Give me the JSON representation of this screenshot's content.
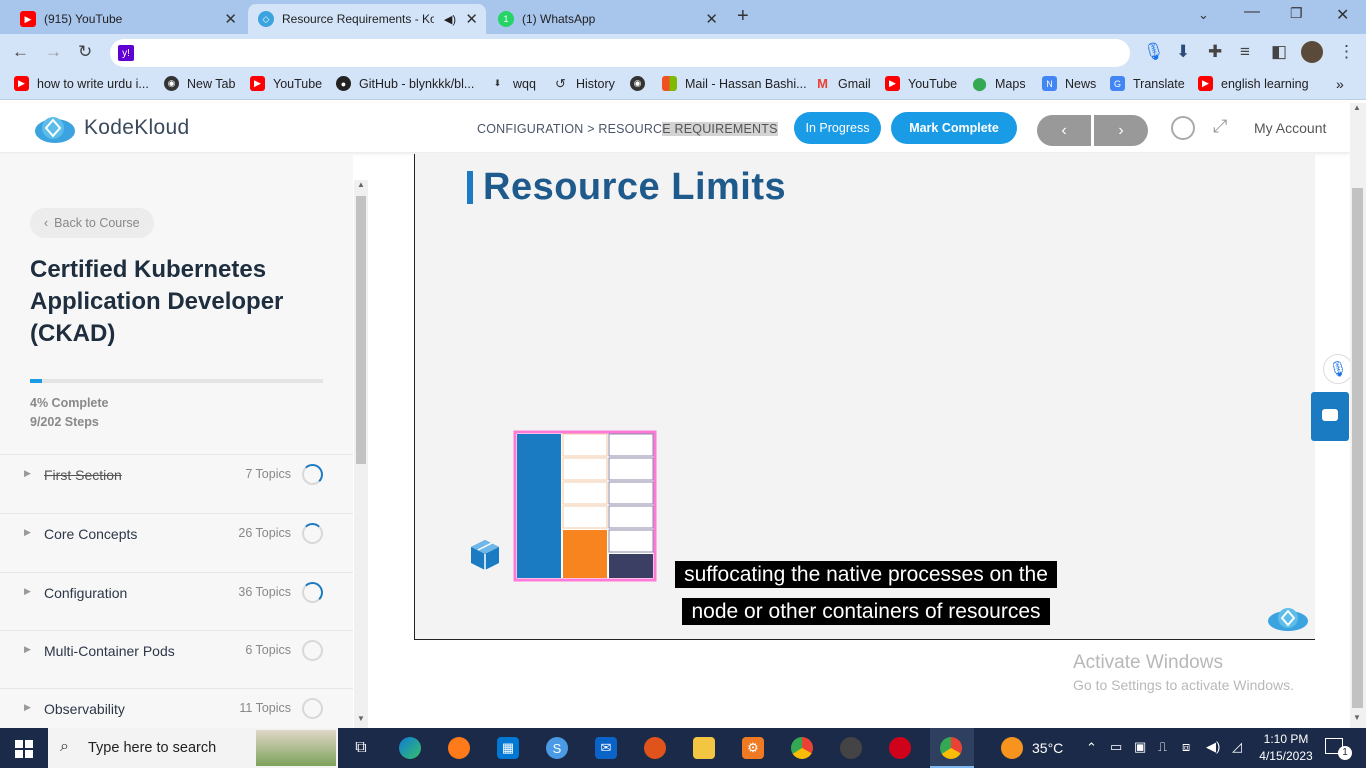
{
  "browser": {
    "tabs": [
      {
        "title": "(915) YouTube",
        "icon": "youtube-icon"
      },
      {
        "title": "Resource Requirements - Ko",
        "icon": "kodekloud-icon",
        "active": true
      },
      {
        "title": "(1) WhatsApp",
        "icon": "whatsapp-icon"
      }
    ],
    "bookmarks": [
      {
        "label": "how to write urdu i...",
        "icon": "youtube-icon"
      },
      {
        "label": "New Tab",
        "icon": "globe-icon"
      },
      {
        "label": "YouTube",
        "icon": "youtube-icon"
      },
      {
        "label": "GitHub - blynkkk/bl...",
        "icon": "github-icon"
      },
      {
        "label": "wqq",
        "icon": "download-icon"
      },
      {
        "label": "History",
        "icon": "history-icon"
      },
      {
        "label": "",
        "icon": "globe-icon"
      },
      {
        "label": "Mail - Hassan Bashi...",
        "icon": "microsoft-icon"
      },
      {
        "label": "Gmail",
        "icon": "gmail-icon"
      },
      {
        "label": "YouTube",
        "icon": "youtube-icon"
      },
      {
        "label": "Maps",
        "icon": "maps-icon"
      },
      {
        "label": "News",
        "icon": "news-icon"
      },
      {
        "label": "Translate",
        "icon": "translate-icon"
      },
      {
        "label": "english learning",
        "icon": "youtube-icon"
      }
    ]
  },
  "header": {
    "logo": "KodeKloud",
    "breadcrumb_a": "CONFIGURATION > RESOURC",
    "breadcrumb_b": "E REQUIREMENTS",
    "status_label": "In Progress",
    "mark_complete": "Mark Complete",
    "prev": "‹",
    "next": "›",
    "account": "My Account"
  },
  "sidebar": {
    "back": "Back to Course",
    "course_title": "Certified Kubernetes Application Developer (CKAD)",
    "progress_percent": 4,
    "progress_text": "4% Complete",
    "steps_text": "9/202 Steps",
    "sections": [
      {
        "name": "First Section",
        "count": "7 Topics",
        "done": true
      },
      {
        "name": "Core Concepts",
        "count": "26 Topics"
      },
      {
        "name": "Configuration",
        "count": "36 Topics"
      },
      {
        "name": "Multi-Container Pods",
        "count": "6 Topics"
      },
      {
        "name": "Observability",
        "count": "11 Topics"
      }
    ]
  },
  "video": {
    "slide_title": "Resource Limits",
    "caption_line1": "suffocating the native processes on the",
    "caption_line2": "node or other containers of resources"
  },
  "watermark": {
    "line1": "Activate Windows",
    "line2": "Go to Settings to activate Windows."
  },
  "taskbar": {
    "search_placeholder": "Type here to search",
    "temperature": "35°C",
    "time": "1:10 PM",
    "date": "4/15/2023",
    "notifications": "1"
  },
  "colors": {
    "accent": "#1a9be6",
    "slide_blue": "#1a7bc2",
    "orange": "#f7841e"
  }
}
